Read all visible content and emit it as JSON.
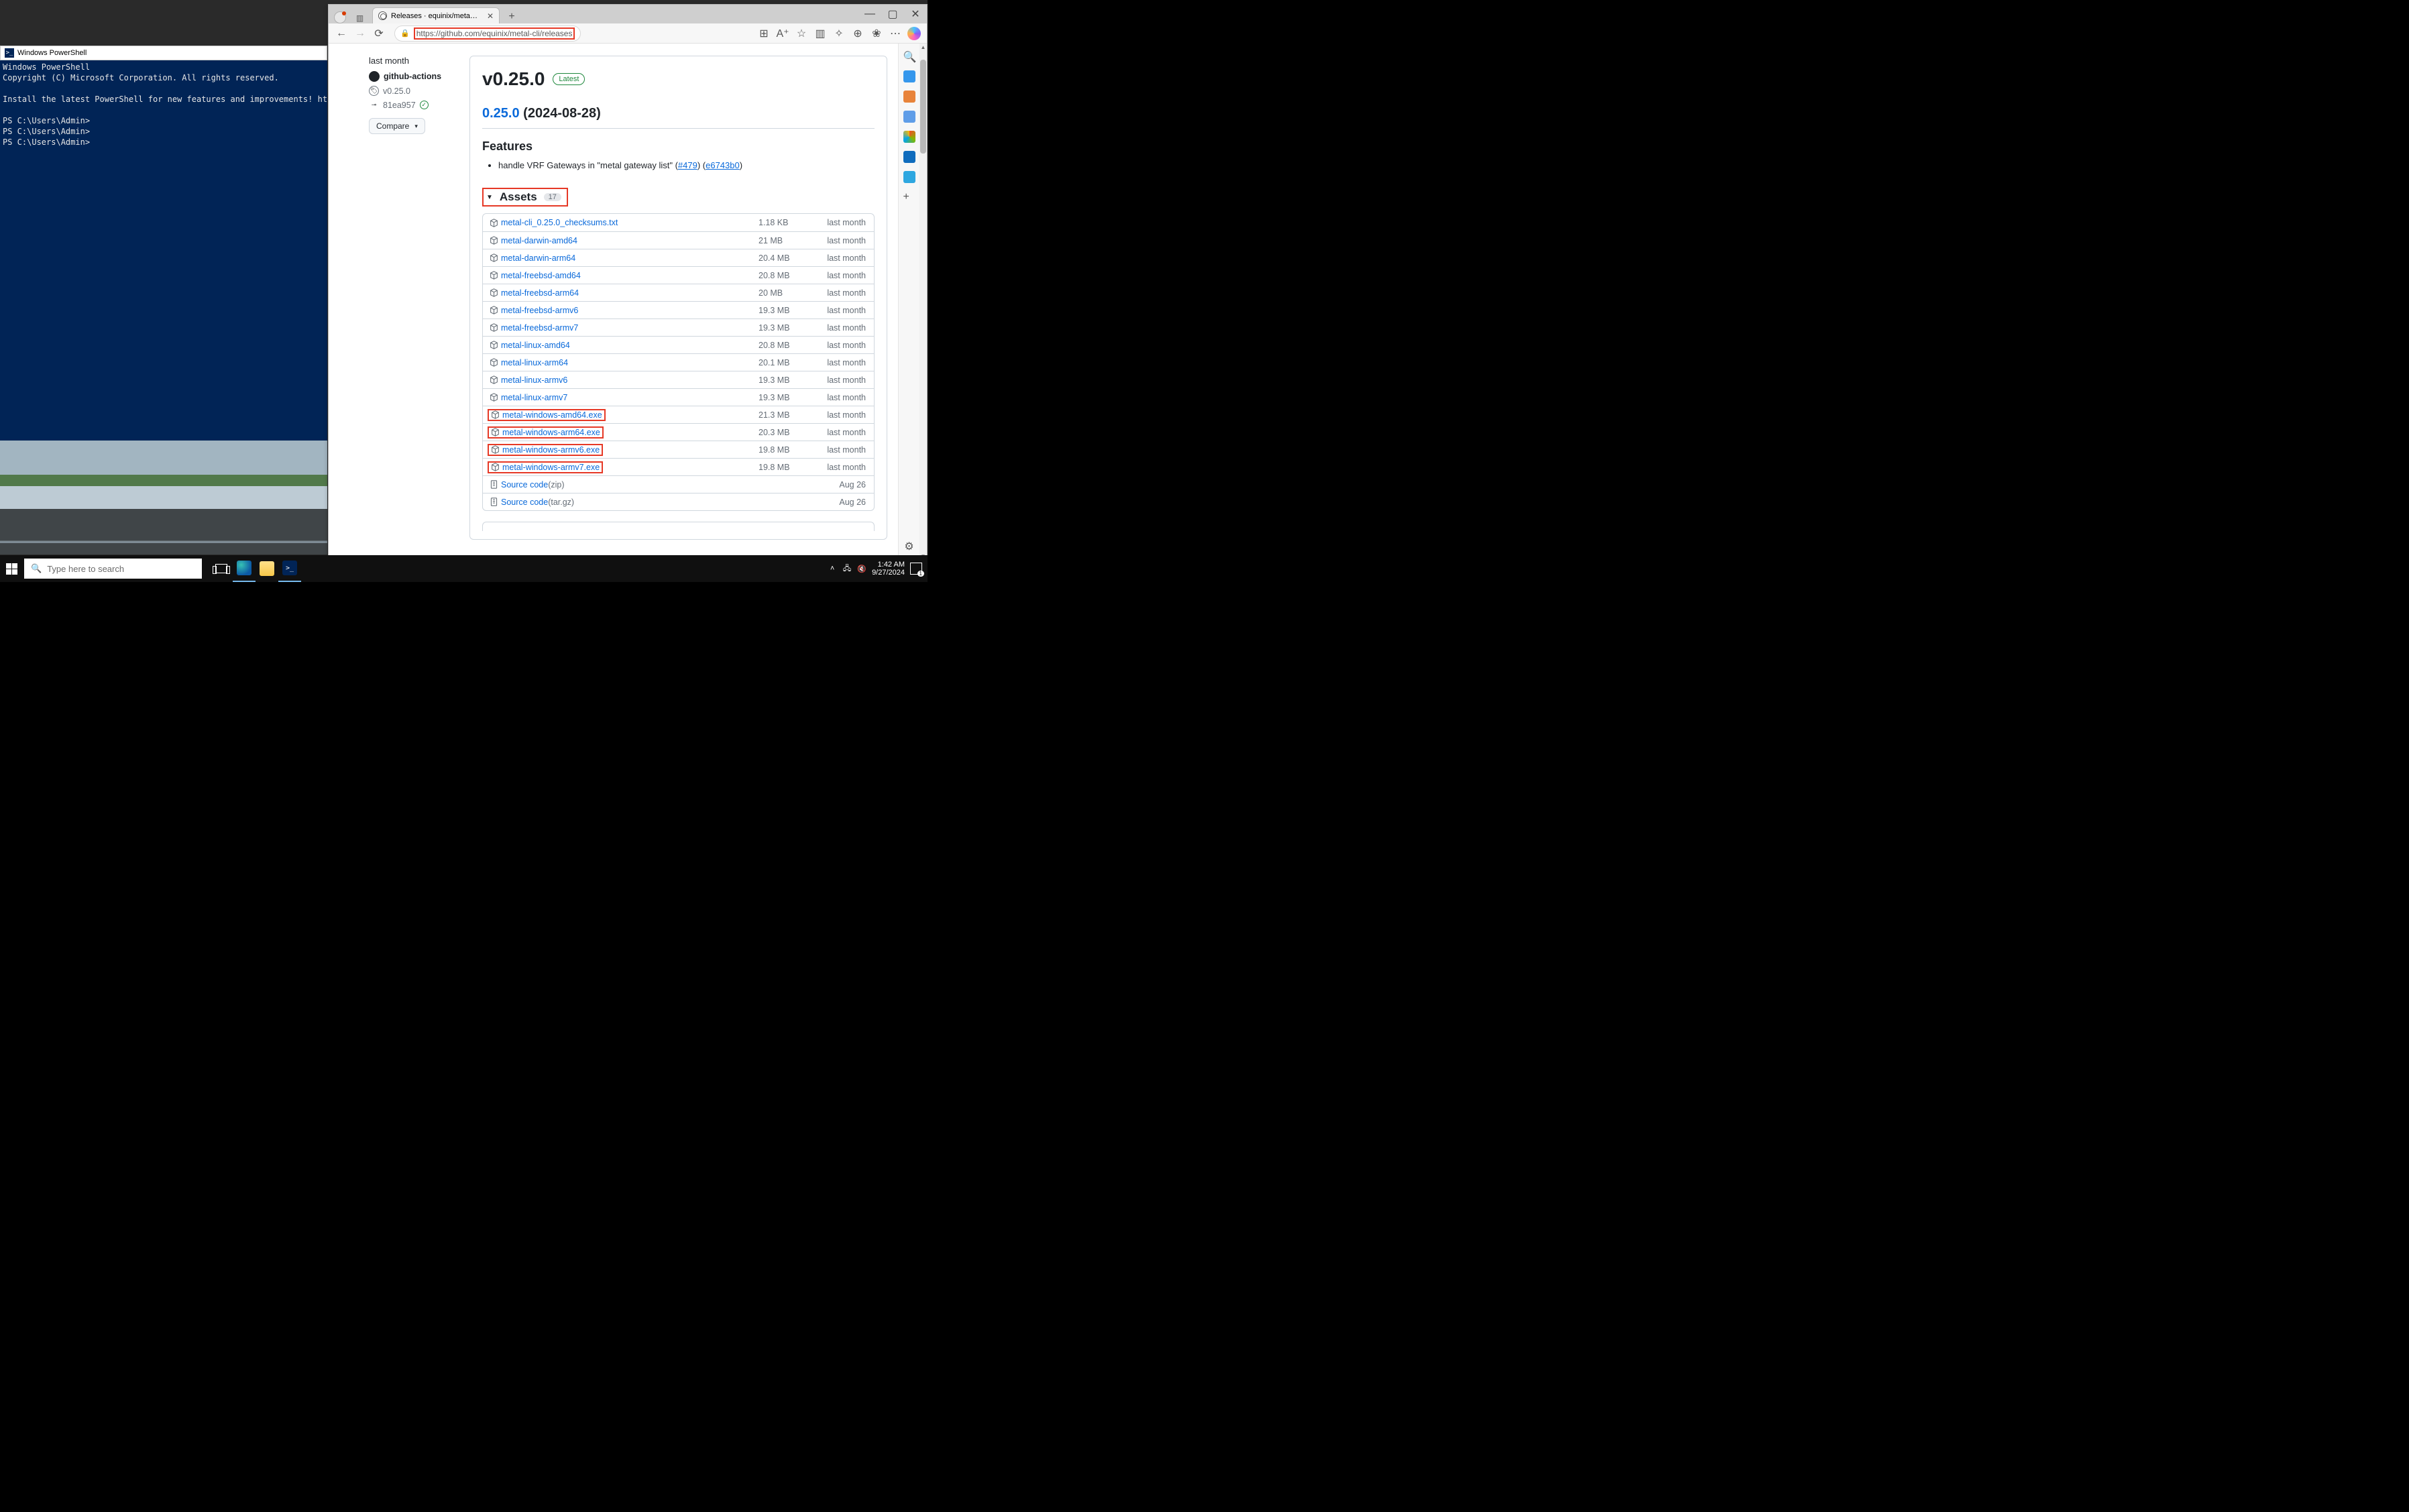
{
  "powershell": {
    "title": "Windows PowerShell",
    "body": "Windows PowerShell\nCopyright (C) Microsoft Corporation. All rights reserved.\n\nInstall the latest PowerShell for new features and improvements! https://aka.ms\n\nPS C:\\Users\\Admin>\nPS C:\\Users\\Admin>\nPS C:\\Users\\Admin>"
  },
  "browser": {
    "tabTitle": "Releases · equinix/metal-cli · GitH",
    "url": "https://github.com/equinix/metal-cli/releases"
  },
  "release": {
    "when": "last month",
    "actor": "github-actions",
    "tag": "v0.25.0",
    "commit": "81ea957",
    "compare": "Compare",
    "title": "v0.25.0",
    "latest": "Latest",
    "linkVersion": "0.25.0",
    "dateText": " (2024-08-28)",
    "featuresHeading": "Features",
    "featureText": "handle VRF Gateways in \"metal gateway list\" (",
    "featurePR": "#479",
    "featureMid": ") (",
    "featureCommit": "e6743b0",
    "featureEnd": ")"
  },
  "assets": {
    "heading": "Assets",
    "count": "17",
    "items": [
      {
        "name": "metal-cli_0.25.0_checksums.txt",
        "size": "1.18 KB",
        "date": "last month",
        "hl": false,
        "kind": "pkg"
      },
      {
        "name": "metal-darwin-amd64",
        "size": "21 MB",
        "date": "last month",
        "hl": false,
        "kind": "pkg"
      },
      {
        "name": "metal-darwin-arm64",
        "size": "20.4 MB",
        "date": "last month",
        "hl": false,
        "kind": "pkg"
      },
      {
        "name": "metal-freebsd-amd64",
        "size": "20.8 MB",
        "date": "last month",
        "hl": false,
        "kind": "pkg"
      },
      {
        "name": "metal-freebsd-arm64",
        "size": "20 MB",
        "date": "last month",
        "hl": false,
        "kind": "pkg"
      },
      {
        "name": "metal-freebsd-armv6",
        "size": "19.3 MB",
        "date": "last month",
        "hl": false,
        "kind": "pkg"
      },
      {
        "name": "metal-freebsd-armv7",
        "size": "19.3 MB",
        "date": "last month",
        "hl": false,
        "kind": "pkg"
      },
      {
        "name": "metal-linux-amd64",
        "size": "20.8 MB",
        "date": "last month",
        "hl": false,
        "kind": "pkg"
      },
      {
        "name": "metal-linux-arm64",
        "size": "20.1 MB",
        "date": "last month",
        "hl": false,
        "kind": "pkg"
      },
      {
        "name": "metal-linux-armv6",
        "size": "19.3 MB",
        "date": "last month",
        "hl": false,
        "kind": "pkg"
      },
      {
        "name": "metal-linux-armv7",
        "size": "19.3 MB",
        "date": "last month",
        "hl": false,
        "kind": "pkg"
      },
      {
        "name": "metal-windows-amd64.exe",
        "size": "21.3 MB",
        "date": "last month",
        "hl": true,
        "kind": "pkg"
      },
      {
        "name": "metal-windows-arm64.exe",
        "size": "20.3 MB",
        "date": "last month",
        "hl": true,
        "kind": "pkg"
      },
      {
        "name": "metal-windows-armv6.exe",
        "size": "19.8 MB",
        "date": "last month",
        "hl": true,
        "kind": "pkg"
      },
      {
        "name": "metal-windows-armv7.exe",
        "size": "19.8 MB",
        "date": "last month",
        "hl": true,
        "kind": "pkg"
      },
      {
        "name": "Source code",
        "ext": " (zip)",
        "size": "",
        "date": "Aug 26",
        "hl": false,
        "kind": "zip"
      },
      {
        "name": "Source code",
        "ext": " (tar.gz)",
        "size": "",
        "date": "Aug 26",
        "hl": false,
        "kind": "zip"
      }
    ]
  },
  "taskbar": {
    "searchPlaceholder": "Type here to search",
    "time": "1:42 AM",
    "date": "9/27/2024",
    "notif": "1"
  }
}
